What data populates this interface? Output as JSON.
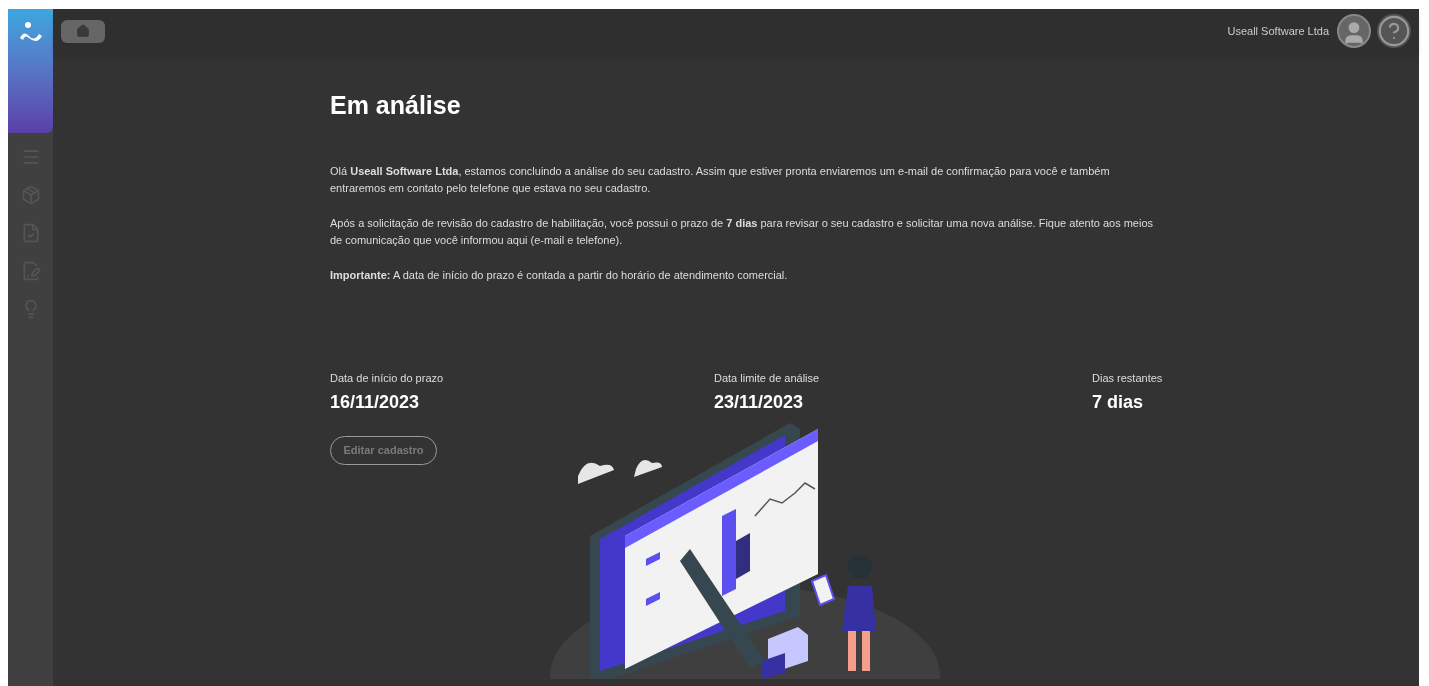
{
  "header": {
    "user_name": "Useall Software Ltda"
  },
  "page": {
    "title": "Em análise",
    "paragraphs": [
      "Olá **Useall Software Ltda**, estamos concluindo a análise do seu cadastro. Assim que estiver pronta enviaremos um e-mail de confirmação para você e também entraremos em contato pelo telefone que estava no seu cadastro.",
      "Após a solicitação de revisão do cadastro de habilitação, você possui o prazo de **7 dias** para revisar o seu cadastro e solicitar uma nova análise. Fique atento aos meios de comunicação que você informou aqui (e-mail e telefone).",
      "**Importante:** A data de início do prazo é contada a partir do horário de atendimento comercial."
    ],
    "stats": [
      {
        "label": "Data de início do prazo",
        "value": "16/11/2023"
      },
      {
        "label": "Data limite de análise",
        "value": "23/11/2023"
      },
      {
        "label": "Dias restantes",
        "value": "7 dias"
      }
    ],
    "edit_button": {
      "label": "Editar cadastro",
      "disabled": true
    }
  }
}
